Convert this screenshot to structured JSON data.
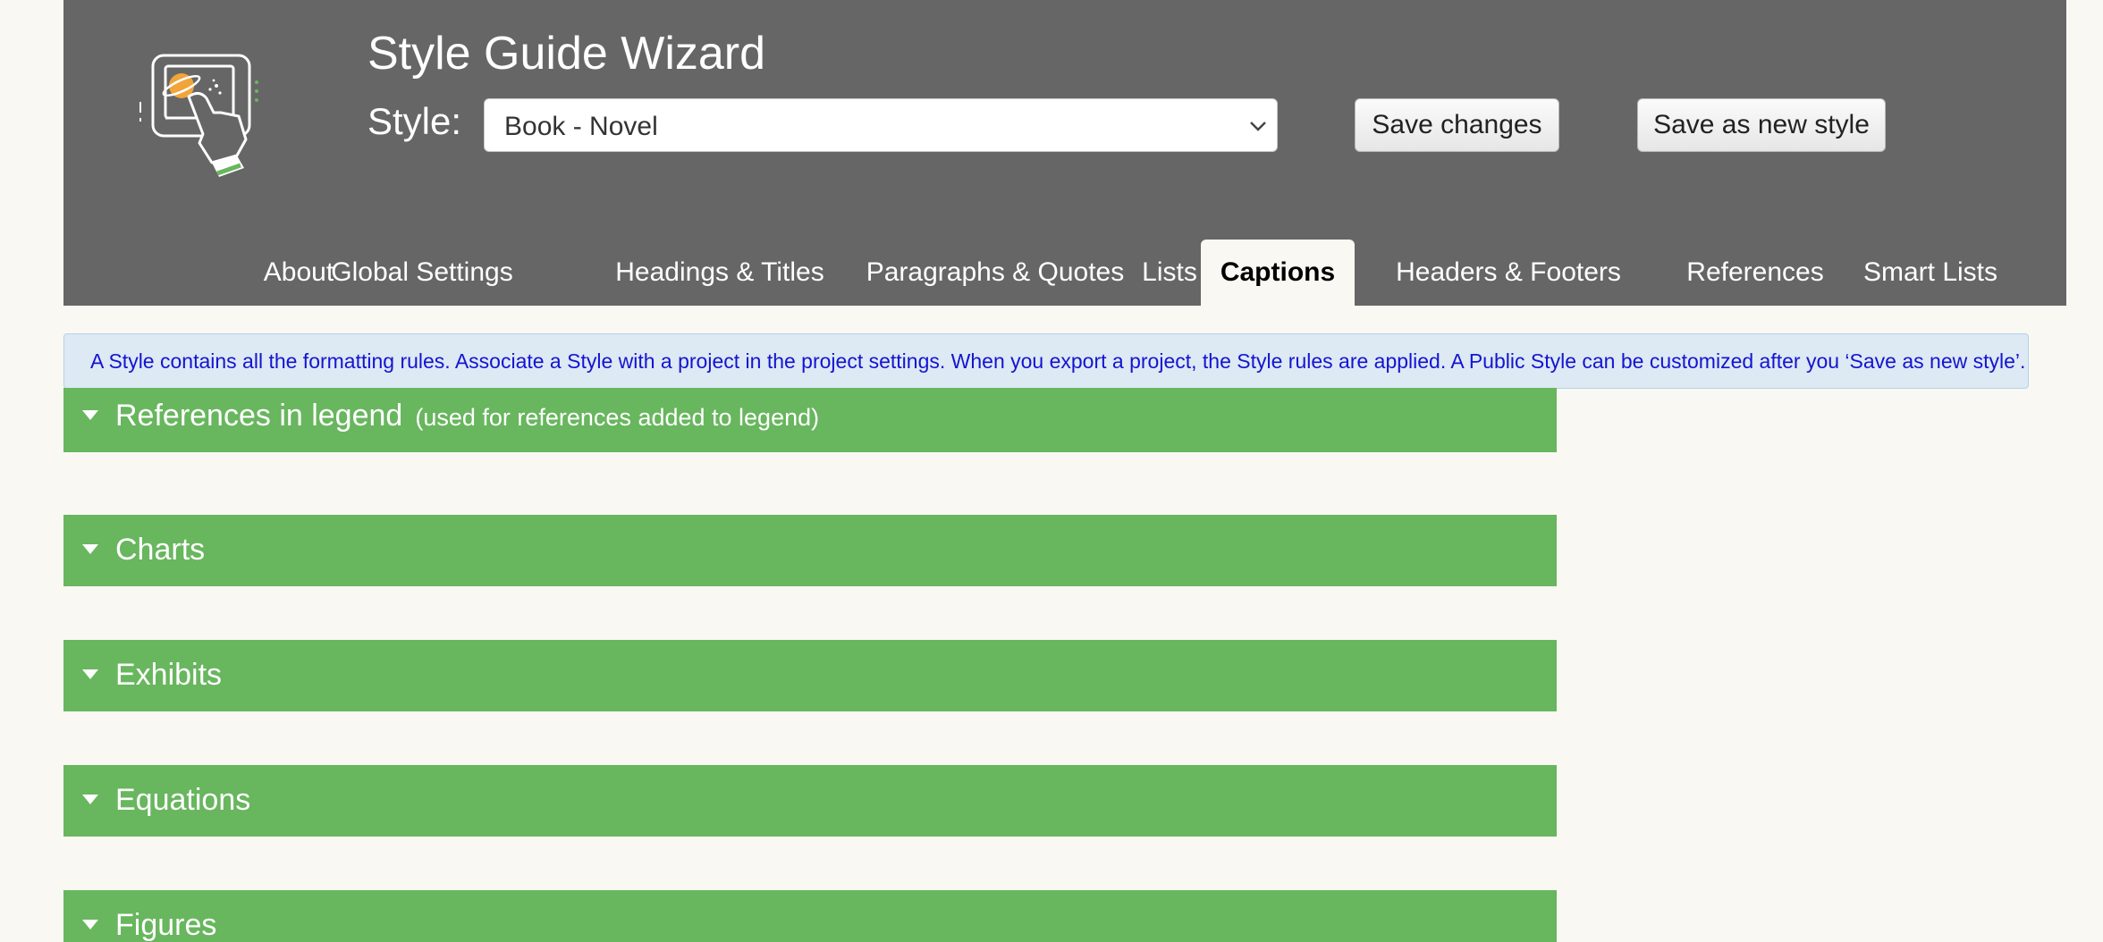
{
  "header": {
    "title": "Style Guide Wizard",
    "style_label": "Style:",
    "style_select": {
      "value": "Book - Novel",
      "icon": "chevron-down-icon"
    },
    "save_label": "Save changes",
    "save_new_label": "Save as new style",
    "logo_icon": "hand-touch-screen-logo"
  },
  "tabs": [
    {
      "label": "About",
      "active": false
    },
    {
      "label": "Global Settings",
      "active": false
    },
    {
      "label": "Headings & Titles",
      "active": false
    },
    {
      "label": "Paragraphs & Quotes",
      "active": false
    },
    {
      "label": "Lists",
      "active": false
    },
    {
      "label": "Captions",
      "active": true
    },
    {
      "label": "Headers & Footers",
      "active": false
    },
    {
      "label": "References",
      "active": false
    },
    {
      "label": "Smart Lists",
      "active": false
    }
  ],
  "info": {
    "text": "A Style contains all the formatting rules. Associate a Style with a project in the project settings. When you export a project, the Style rules are applied. A Public Style can be customized after you ‘Save as new style’."
  },
  "sections": [
    {
      "title": "References in legend",
      "subtitle": "(used for references added to legend)"
    },
    {
      "title": "Charts"
    },
    {
      "title": "Exhibits"
    },
    {
      "title": "Equations"
    },
    {
      "title": "Figures"
    }
  ],
  "colors": {
    "header_bg": "#666666",
    "page_bg": "#f9f8f3",
    "section_bg": "#68b65e",
    "info_bg": "#dde9f3",
    "info_text": "#1414d2"
  }
}
